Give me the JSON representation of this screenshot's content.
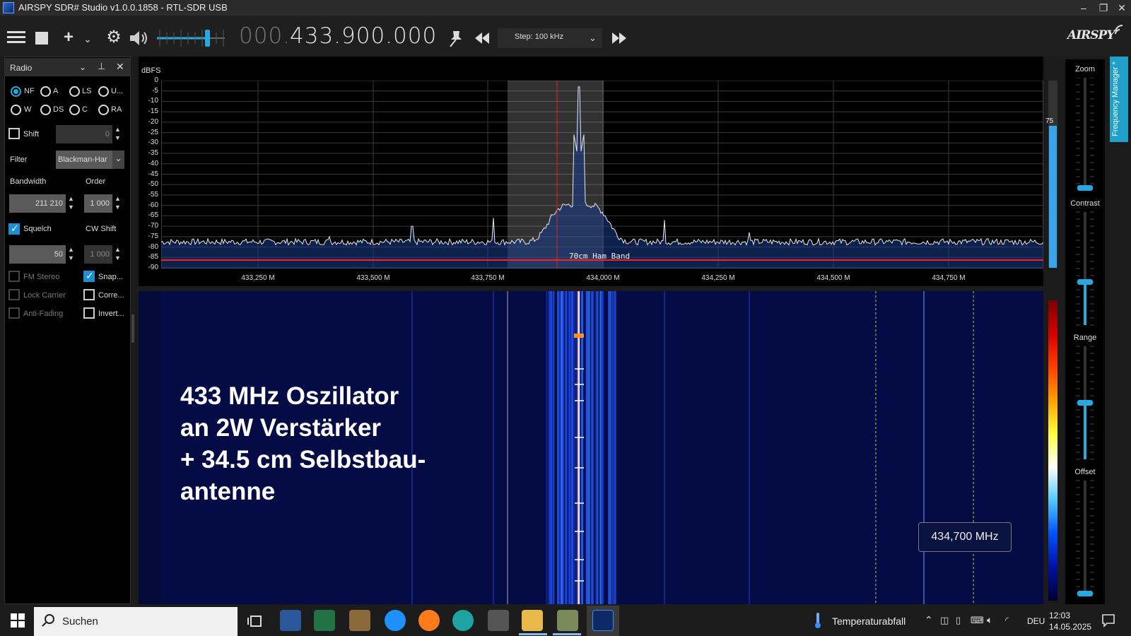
{
  "window": {
    "title": "AIRSPY SDR# Studio v1.0.0.1858 - RTL-SDR USB",
    "minimize": "–",
    "maximize": "❐",
    "close": "✕"
  },
  "toolbar": {
    "frequency_dim": "000.",
    "frequency_bright": "433.900.000",
    "step_label": "Step: 100 kHz",
    "logo": "AIRSPY",
    "icons": [
      "menu-icon",
      "stop-icon",
      "add-icon",
      "chevron-down-icon",
      "gear-icon",
      "speaker-icon",
      "pin-icon",
      "rewind-icon",
      "fast-forward-icon"
    ]
  },
  "radio_panel": {
    "title": "Radio",
    "modes_row1": [
      "NF",
      "A",
      "LS",
      "U..."
    ],
    "modes_row2": [
      "W",
      "DS",
      "C",
      "RA"
    ],
    "selected_mode": "NF",
    "shift_label": "Shift",
    "shift_value": "0",
    "filter_label": "Filter",
    "filter_value": "Blackman-Har",
    "bandwidth_label": "Bandwidth",
    "bandwidth_value": "211 210",
    "order_label": "Order",
    "order_value": "1 000",
    "squelch_label": "Squelch",
    "squelch_value": "50",
    "cw_shift_label": "CW Shift",
    "cw_shift_value": "1 000",
    "fm_stereo_label": "FM Stereo",
    "snap_label": "Snap...",
    "lock_carrier_label": "Lock Carrier",
    "correct_label": "Corre...",
    "anti_fading_label": "Anti-Fading",
    "invert_label": "Invert..."
  },
  "spectrum": {
    "unit_label": "dBFS",
    "y_ticks": [
      "0",
      "-5",
      "-10",
      "-15",
      "-20",
      "-25",
      "-30",
      "-35",
      "-40",
      "-45",
      "-50",
      "-55",
      "-60",
      "-65",
      "-70",
      "-75",
      "-80",
      "-85",
      "-90"
    ],
    "x_ticks": [
      "433,250 M",
      "433,500 M",
      "433,750 M",
      "434,000 M",
      "434,250 M",
      "434,500 M",
      "434,750 M"
    ],
    "band_label": "70cm Ham Band",
    "level_value": "75"
  },
  "waterfall": {
    "overlay_line1": "433 MHz Oszillator",
    "overlay_line2": "an 2W Verstärker",
    "overlay_line3": "+ 34.5 cm Selbstbau-",
    "overlay_line4": "antenne",
    "tooltip": "434,700 MHz"
  },
  "sliders": {
    "zoom": "Zoom",
    "contrast": "Contrast",
    "range": "Range",
    "offset": "Offset",
    "frequency_manager_tab": "Frequency Manager *"
  },
  "taskbar": {
    "search_placeholder": "Suchen",
    "weather": "Temperaturabfall",
    "language": "DEU",
    "time": "12:03",
    "date": "14.05.2025"
  }
}
